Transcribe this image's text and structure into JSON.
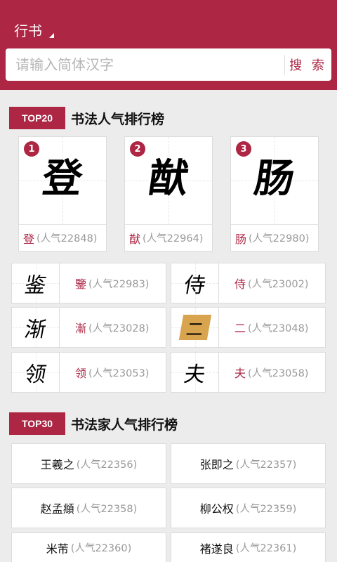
{
  "header": {
    "style_label": "行书",
    "search_placeholder": "请输入简体汉字",
    "search_button": "搜 索"
  },
  "top20": {
    "badge": "TOP20",
    "title": "书法人气排行榜",
    "podium": [
      {
        "rank": "1",
        "char": "登",
        "popularity": "(人气22848)"
      },
      {
        "rank": "2",
        "char": "猷",
        "popularity": "(人气22964)"
      },
      {
        "rank": "3",
        "char": "肠",
        "popularity": "(人气22980)"
      }
    ],
    "list": [
      {
        "char": "鑒",
        "glyph": "鉴",
        "popularity": "(人气22983)"
      },
      {
        "char": "侍",
        "glyph": "侍",
        "popularity": "(人气23002)"
      },
      {
        "char": "漸",
        "glyph": "渐",
        "popularity": "(人气23028)"
      },
      {
        "char": "二",
        "glyph": "二",
        "popularity": "(人气23048)"
      },
      {
        "char": "领",
        "glyph": "领",
        "popularity": "(人气23053)"
      },
      {
        "char": "夫",
        "glyph": "夫",
        "popularity": "(人气23058)"
      }
    ]
  },
  "top30": {
    "badge": "TOP30",
    "title": "书法家人气排行榜",
    "artists": [
      {
        "name": "王羲之",
        "popularity": "(人气22356)"
      },
      {
        "name": "张即之",
        "popularity": "(人气22357)"
      },
      {
        "name": "赵孟頫",
        "popularity": "(人气22358)"
      },
      {
        "name": "柳公权",
        "popularity": "(人气22359)"
      },
      {
        "name": "米芾",
        "popularity": "(人气22360)"
      },
      {
        "name": "褚遂良",
        "popularity": "(人气22361)"
      }
    ]
  },
  "colors": {
    "brand": "#ad2644",
    "background": "#ececec"
  }
}
